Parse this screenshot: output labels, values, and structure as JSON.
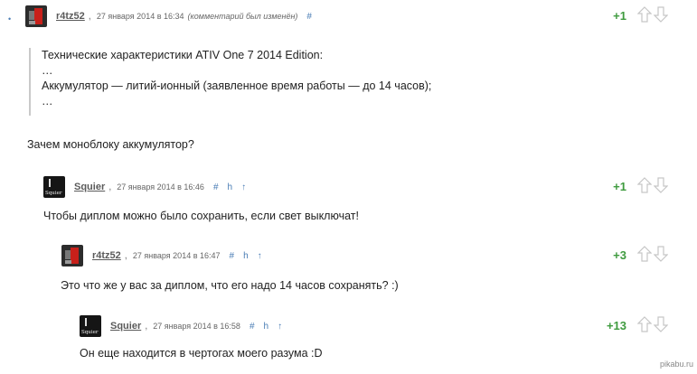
{
  "comments": [
    {
      "user": "r4tz52",
      "sep": ",",
      "date": "27 января 2014 в 16:34",
      "edited": "(комментарий был изменён)",
      "hash": "#",
      "rating": "+1",
      "quote": [
        "Технические характеристики ATIV One 7 2014 Edition:",
        "…",
        "Аккумулятор — литий-ионный (заявленное время работы — до 14 часов);",
        "…"
      ],
      "text": "Зачем моноблоку аккумулятор?"
    },
    {
      "user": "Squier",
      "sep": ",",
      "date": "27 января 2014 в 16:46",
      "hash": "#",
      "tree": "h",
      "up": "↑",
      "rating": "+1",
      "text": "Чтобы диплом можно было сохранить, если свет выключат!"
    },
    {
      "user": "r4tz52",
      "sep": ",",
      "date": "27 января 2014 в 16:47",
      "hash": "#",
      "tree": "h",
      "up": "↑",
      "rating": "+3",
      "text": "Это что же у вас за диплом, что его надо 14 часов сохранять? :)"
    },
    {
      "user": "Squier",
      "sep": ",",
      "date": "27 января 2014 в 16:58",
      "hash": "#",
      "tree": "h",
      "up": "↑",
      "rating": "+13",
      "text": "Он еще находится в чертогах моего разума :D"
    }
  ],
  "watermark": "pikabu.ru",
  "colors": {
    "rating_green": "#3f9b3f",
    "link_blue": "#4a7db5",
    "quote_border": "#c9c9c9"
  }
}
